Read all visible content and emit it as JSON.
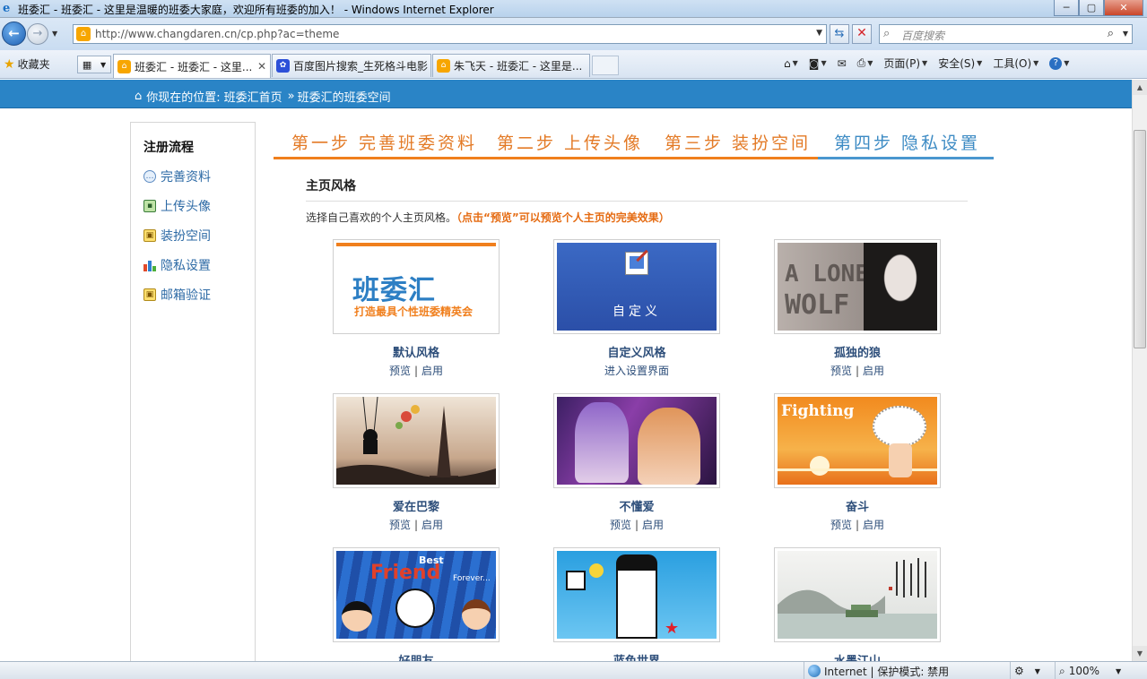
{
  "window": {
    "title": "班委汇 - 班委汇 - 这里是温暖的班委大家庭，欢迎所有班委的加入！ - Windows Internet Explorer",
    "min": "─",
    "max": "▢",
    "close": "✕"
  },
  "address": {
    "url": "http://www.changdaren.cn/cp.php?ac=theme",
    "search_placeholder": "百度搜索"
  },
  "toolbar": {
    "favorites": "收藏夹",
    "tabs": [
      {
        "label": "班委汇 - 班委汇 - 这里...",
        "active": true
      },
      {
        "label": "百度图片搜索_生死格斗电影",
        "active": false
      },
      {
        "label": "朱飞天 - 班委汇 - 这里是...",
        "active": false
      }
    ],
    "commands": {
      "page": "页面(P)",
      "safety": "安全(S)",
      "tools": "工具(O)"
    }
  },
  "breadcrumb": {
    "prefix": "你现在的位置:",
    "home": "班委汇首页",
    "sep": "»",
    "current": "班委汇的班委空间"
  },
  "sidebar": {
    "title": "注册流程",
    "items": [
      {
        "label": "完善资料",
        "icon": "speech-bubble-icon"
      },
      {
        "label": "上传头像",
        "icon": "picture-icon"
      },
      {
        "label": "装扮空间",
        "icon": "lock-icon"
      },
      {
        "label": "隐私设置",
        "icon": "bar-chart-icon"
      },
      {
        "label": "邮箱验证",
        "icon": "lock-icon"
      }
    ]
  },
  "steps": [
    {
      "label": "第一步 完善班委资料"
    },
    {
      "label": "第二步 上传头像"
    },
    {
      "label": "第三步 装扮空间"
    },
    {
      "label": "第四步 隐私设置"
    }
  ],
  "main": {
    "title": "主页风格",
    "desc": "选择自己喜欢的个人主页风格。",
    "desc_highlight": "（点击“预览”可以预览个人主页的完美效果）",
    "preview": "预览",
    "apply": "启用",
    "sep": "|",
    "themes": [
      {
        "name": "默认风格",
        "logo": "班委汇",
        "slogan": "打造最具个性班委精英会"
      },
      {
        "name": "自定义风格",
        "link": "进入设置界面",
        "caption": "自定义"
      },
      {
        "name": "孤独的狼",
        "caption1": "A LONE",
        "caption2": "WOLF"
      },
      {
        "name": "爱在巴黎"
      },
      {
        "name": "不懂爱"
      },
      {
        "name": "奋斗",
        "caption": "Fighting"
      },
      {
        "name": "好朋友",
        "caption1": "Best",
        "caption2": "Friend",
        "caption3": "Forever..."
      },
      {
        "name": "蓝色世界"
      },
      {
        "name": "水墨江山"
      }
    ]
  },
  "status": {
    "zone": "Internet | 保护模式: 禁用",
    "zoom": "100%"
  }
}
